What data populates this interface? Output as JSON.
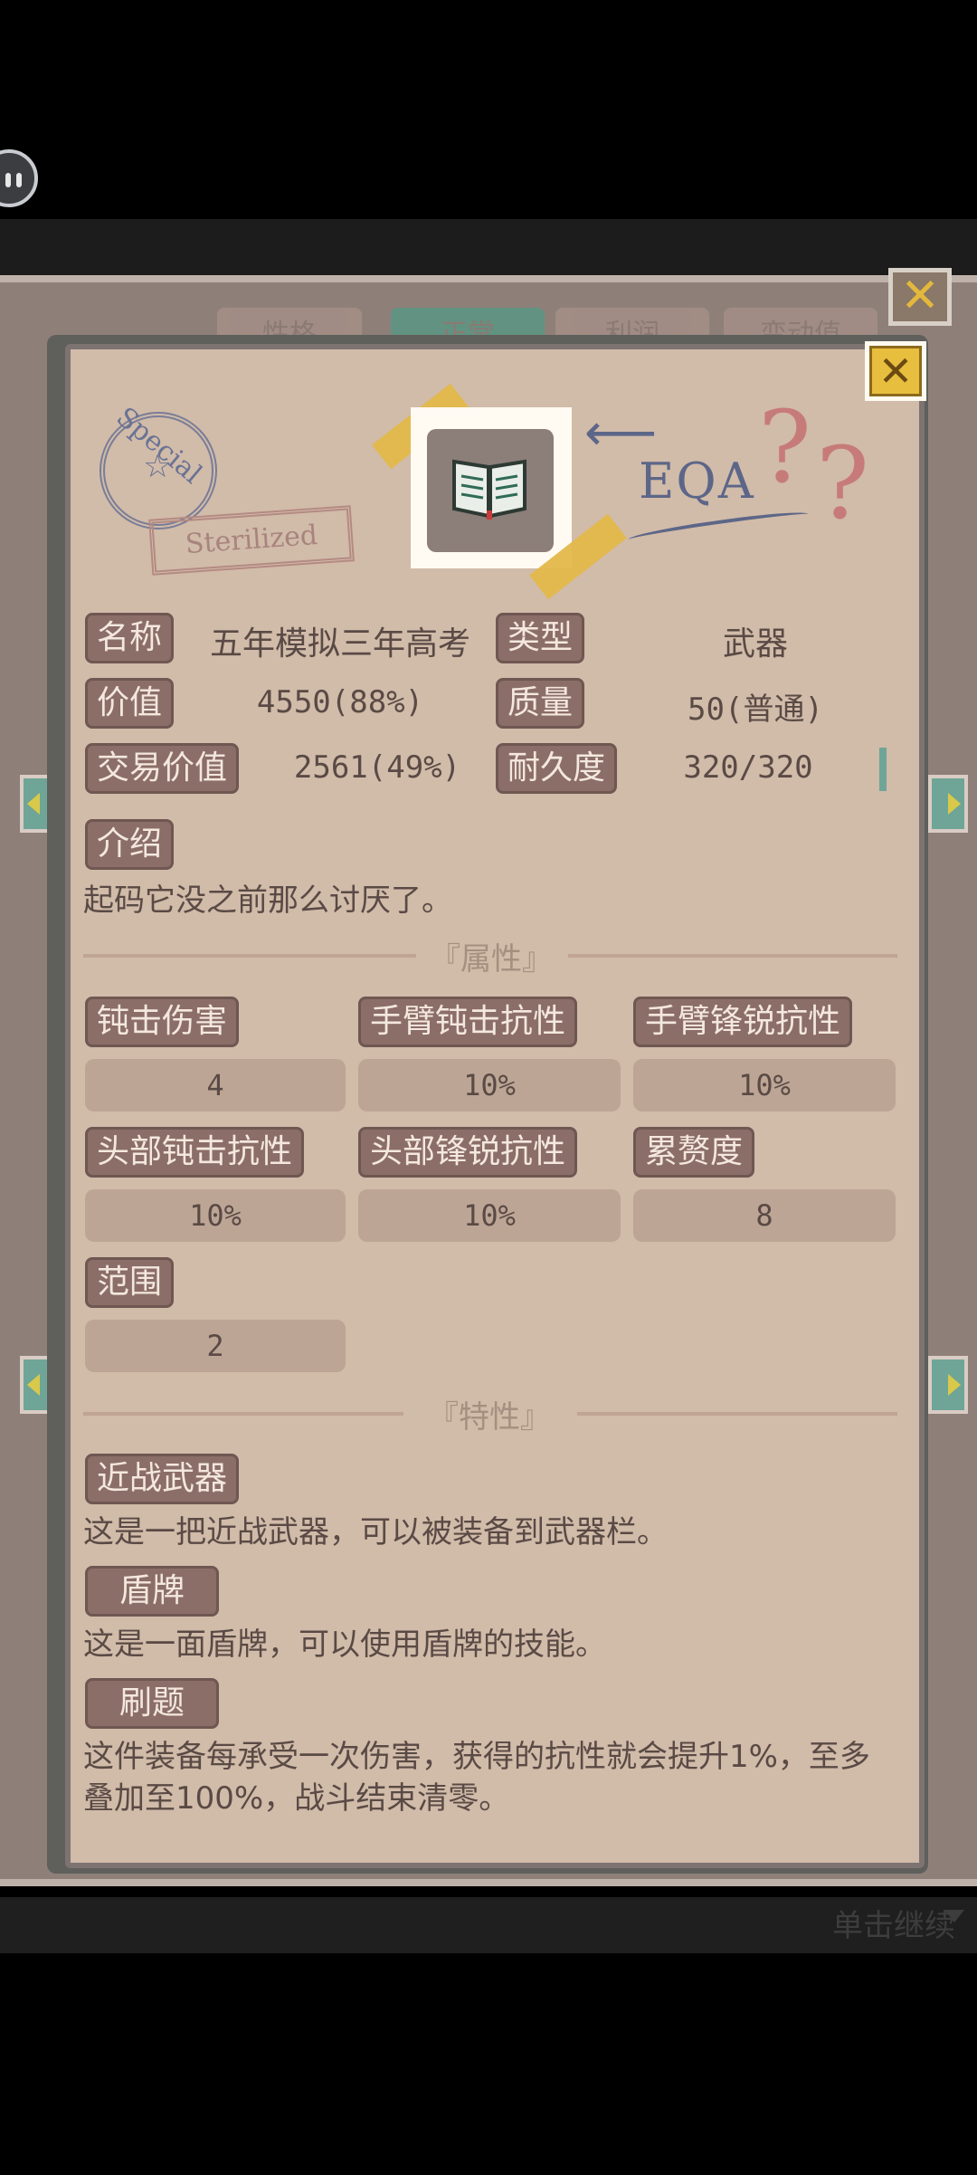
{
  "header": {
    "hint": "单击继续"
  },
  "background_tabs": [
    "性格",
    "正常",
    "利润",
    "变动值"
  ],
  "dialog": {
    "stamp_text": "Special",
    "stamp_label": "Sterilized",
    "eqa_text": "EQA",
    "info": [
      {
        "label": "名称",
        "value": "五年模拟三年高考"
      },
      {
        "label": "类型",
        "value": "武器"
      },
      {
        "label": "价值",
        "value": "4550(88%)"
      },
      {
        "label": "质量",
        "value": "50(普通)"
      },
      {
        "label": "交易价值",
        "value": "2561(49%)"
      },
      {
        "label": "耐久度",
        "value": "320/320"
      }
    ],
    "intro_label": "介绍",
    "intro_text": "起码它没之前那么讨厌了。",
    "attributes_title": "『属性』",
    "attributes": [
      {
        "label": "钝击伤害",
        "value": "4"
      },
      {
        "label": "手臂钝击抗性",
        "value": "10%"
      },
      {
        "label": "手臂锋锐抗性",
        "value": "10%"
      },
      {
        "label": "头部钝击抗性",
        "value": "10%"
      },
      {
        "label": "头部锋锐抗性",
        "value": "10%"
      },
      {
        "label": "累赘度",
        "value": "8"
      },
      {
        "label": "范围",
        "value": "2"
      }
    ],
    "traits_title": "『特性』",
    "traits": [
      {
        "label": "近战武器",
        "text": "这是一把近战武器，可以被装备到武器栏。"
      },
      {
        "label": "盾牌",
        "text": "这是一面盾牌，可以使用盾牌的技能。"
      },
      {
        "label": "刷题",
        "text": "这件装备每承受一次伤害，获得的抗性就会提升1%，至多叠加至100%，战斗结束清零。"
      }
    ],
    "durability_fraction": 1.0
  },
  "colors": {
    "panel": "#d1bba9",
    "chip": "#8b6e67",
    "accent": "#6fa596",
    "close": "#e8be3e"
  }
}
